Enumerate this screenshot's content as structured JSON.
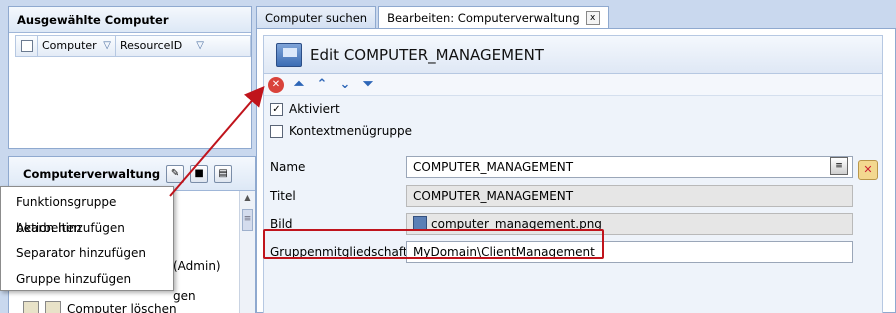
{
  "selected_panel": {
    "title": "Ausgewählte Computer",
    "columns": [
      "Computer",
      "ResourceID"
    ]
  },
  "computer_panel": {
    "title": "Computerverwaltung",
    "rows": [
      "(Admin)",
      "gen"
    ],
    "last_row": "Computer löschen"
  },
  "context_menu": {
    "items": [
      "Funktionsgruppe bearbeiten",
      "Aktion hinzufügen",
      "Separator hinzufügen",
      "Gruppe hinzufügen"
    ]
  },
  "tabs": [
    {
      "label": "Computer suchen"
    },
    {
      "label": "Bearbeiten: Computerverwaltung",
      "close": "x"
    }
  ],
  "edit": {
    "title": "Edit COMPUTER_MANAGEMENT",
    "checkbox_activated": {
      "label": "Aktiviert",
      "checked": true
    },
    "checkbox_context": {
      "label": "Kontextmenügruppe",
      "checked": false
    },
    "name": {
      "label": "Name",
      "value": "COMPUTER_MANAGEMENT"
    },
    "title_field": {
      "label": "Titel",
      "value": "COMPUTER_MANAGEMENT"
    },
    "image": {
      "label": "Bild",
      "value": "computer_management.png"
    },
    "group_membership": {
      "label": "Gruppenmitgliedschaft",
      "value": "MyDomain\\ClientManagement"
    }
  },
  "colors": {
    "highlight": "#c0141c",
    "accent": "#2d66b7"
  }
}
